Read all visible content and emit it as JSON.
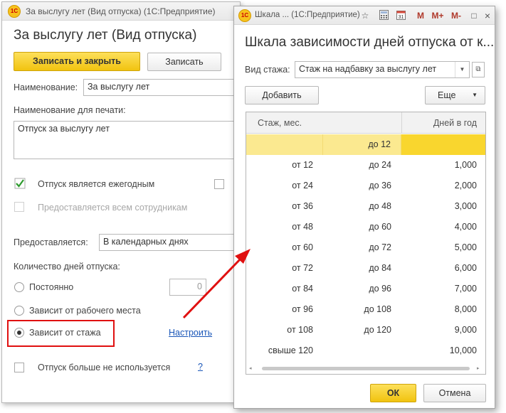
{
  "back_window": {
    "title": "За выслугу лет (Вид отпуска)  (1С:Предприятие)",
    "logo": "1С",
    "form_title": "За выслугу лет (Вид отпуска)",
    "save_close_label": "Записать и закрыть",
    "save_label": "Записать",
    "name_label": "Наименование:",
    "name_value": "За выслугу лет",
    "print_name_label": "Наименование для печати:",
    "print_name_value": "Отпуск за выслугу лет",
    "annual_label": "Отпуск является ежегодным",
    "all_employees_label": "Предоставляется всем сотрудникам",
    "provided_label": "Предоставляется:",
    "provided_value": "В календарных днях",
    "days_count_label": "Количество дней отпуска:",
    "const_label": "Постоянно",
    "const_value": "0",
    "workplace_label": "Зависит от рабочего места",
    "seniority_label": "Зависит от стажа",
    "configure_link": "Настроить",
    "unused_label": "Отпуск больше не используется",
    "help_link": "?"
  },
  "front_window": {
    "title": "Шкала ...  (1С:Предприятие)",
    "logo": "1С",
    "toolbar_icons": [
      "star-icon",
      "calculator-icon",
      "calendar-icon",
      "M",
      "M+",
      "M-",
      "□",
      "×"
    ],
    "form_title": "Шкала зависимости дней отпуска от к...",
    "experience_type_label": "Вид стажа:",
    "experience_type_value": "Стаж на надбавку за выслугу лет",
    "add_label": "Добавить",
    "more_label": "Еще",
    "columns": [
      "Стаж, мес.",
      "Дней в год"
    ],
    "rows": [
      {
        "from": "",
        "to": "до 12",
        "days": ""
      },
      {
        "from": "от 12",
        "to": "до 24",
        "days": "1,000"
      },
      {
        "from": "от 24",
        "to": "до 36",
        "days": "2,000"
      },
      {
        "from": "от 36",
        "to": "до 48",
        "days": "3,000"
      },
      {
        "from": "от 48",
        "to": "до 60",
        "days": "4,000"
      },
      {
        "from": "от 60",
        "to": "до 72",
        "days": "5,000"
      },
      {
        "from": "от 72",
        "to": "до 84",
        "days": "6,000"
      },
      {
        "from": "от 84",
        "to": "до 96",
        "days": "7,000"
      },
      {
        "from": "от 96",
        "to": "до 108",
        "days": "8,000"
      },
      {
        "from": "от 108",
        "to": "до 120",
        "days": "9,000"
      },
      {
        "from": "свыше 120",
        "to": "",
        "days": "10,000"
      }
    ],
    "ok_label": "ОК",
    "cancel_label": "Отмена"
  },
  "colors": {
    "accent_yellow": "#f5c518",
    "selection_row": "#fbe990",
    "annotation_red": "#e01010",
    "link_blue": "#1a56b8",
    "check_green": "#2e9b2e"
  }
}
